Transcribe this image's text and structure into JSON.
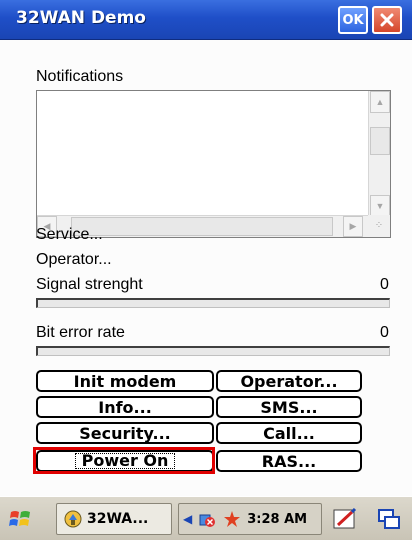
{
  "window": {
    "title": "32WAN Demo",
    "ok_label": "OK",
    "close_icon": "close-icon"
  },
  "main": {
    "notifications_label": "Notifications",
    "notifications_items": [],
    "service_label": "Service...",
    "operator_label": "Operator...",
    "signal_label": "Signal strenght",
    "signal_value": "0",
    "signal_progress": 0,
    "ber_label": "Bit error rate",
    "ber_value": "0",
    "ber_progress": 0
  },
  "buttons": {
    "init_modem": "Init modem",
    "operator": "Operator...",
    "info": "Info...",
    "sms": "SMS...",
    "security": "Security...",
    "call": "Call...",
    "power_on": "Power On",
    "ras": "RAS..."
  },
  "highlight": {
    "color": "#e00000",
    "target": "power_on"
  },
  "taskbar": {
    "start_icon": "windows-flag-icon",
    "task_label": "32WA...",
    "task_icon": "app-icon",
    "tray_icons": [
      "volume-icon",
      "connectivity-icon",
      "network-icon"
    ],
    "time": "3:28 AM",
    "sip_icon": "input-panel-icon",
    "desktop_icon": "desktop-icon"
  },
  "colors": {
    "title_bar": "#1f4fc8",
    "taskbar": "#c9c4b6"
  }
}
